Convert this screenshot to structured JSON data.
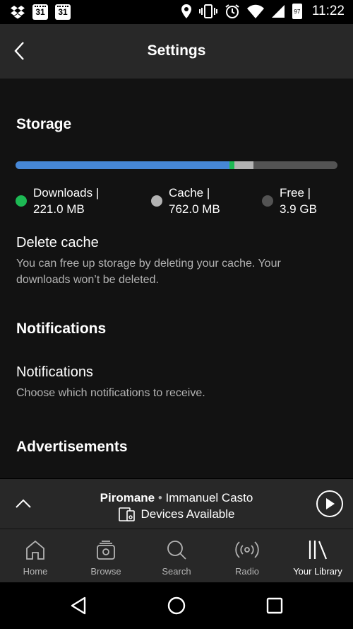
{
  "status_bar": {
    "calendar_day_1": "31",
    "calendar_day_2": "31",
    "battery_level": "97",
    "time": "11:22",
    "icons": [
      "dropbox-icon",
      "calendar-icon",
      "calendar-icon",
      "location-icon",
      "vibrate-icon",
      "alarm-icon",
      "wifi-icon",
      "cell-signal-icon",
      "battery-icon"
    ]
  },
  "header": {
    "title": "Settings",
    "back_icon": "chevron-left-icon"
  },
  "storage": {
    "title": "Storage",
    "usage_fraction": {
      "downloads": 0.665,
      "other": 0.015,
      "cache": 0.06
    },
    "legend": [
      {
        "label": "Downloads |",
        "value": "221.0 MB",
        "color": "#1db954"
      },
      {
        "label": "Cache |",
        "value": "762.0 MB",
        "color": "#b3b3b3"
      },
      {
        "label": "Free |",
        "value": "3.9 GB",
        "color": "#535353"
      }
    ],
    "bar_colors": {
      "downloads": "#4687d6",
      "other": "#1db954",
      "cache": "#b3b3b3",
      "free": "#535353"
    }
  },
  "delete_cache": {
    "title": "Delete cache",
    "description": "You can free up storage by deleting your cache. Your downloads won’t be deleted."
  },
  "notifications_section": {
    "title": "Notifications",
    "item_title": "Notifications",
    "item_description": "Choose which notifications to receive."
  },
  "advertisements_section": {
    "title": "Advertisements"
  },
  "now_playing": {
    "song": "Piromane",
    "separator": " • ",
    "artist": "Immanuel Casto",
    "devices_label": "Devices Available"
  },
  "tabs": [
    {
      "label": "Home",
      "icon": "home-icon",
      "active": false
    },
    {
      "label": "Browse",
      "icon": "browse-icon",
      "active": false
    },
    {
      "label": "Search",
      "icon": "search-icon",
      "active": false
    },
    {
      "label": "Radio",
      "icon": "radio-icon",
      "active": false
    },
    {
      "label": "Your Library",
      "icon": "library-icon",
      "active": true
    }
  ],
  "colors": {
    "background": "#121212",
    "header": "#282828",
    "accent": "#1db954",
    "downloads_bar": "#4687d6"
  }
}
